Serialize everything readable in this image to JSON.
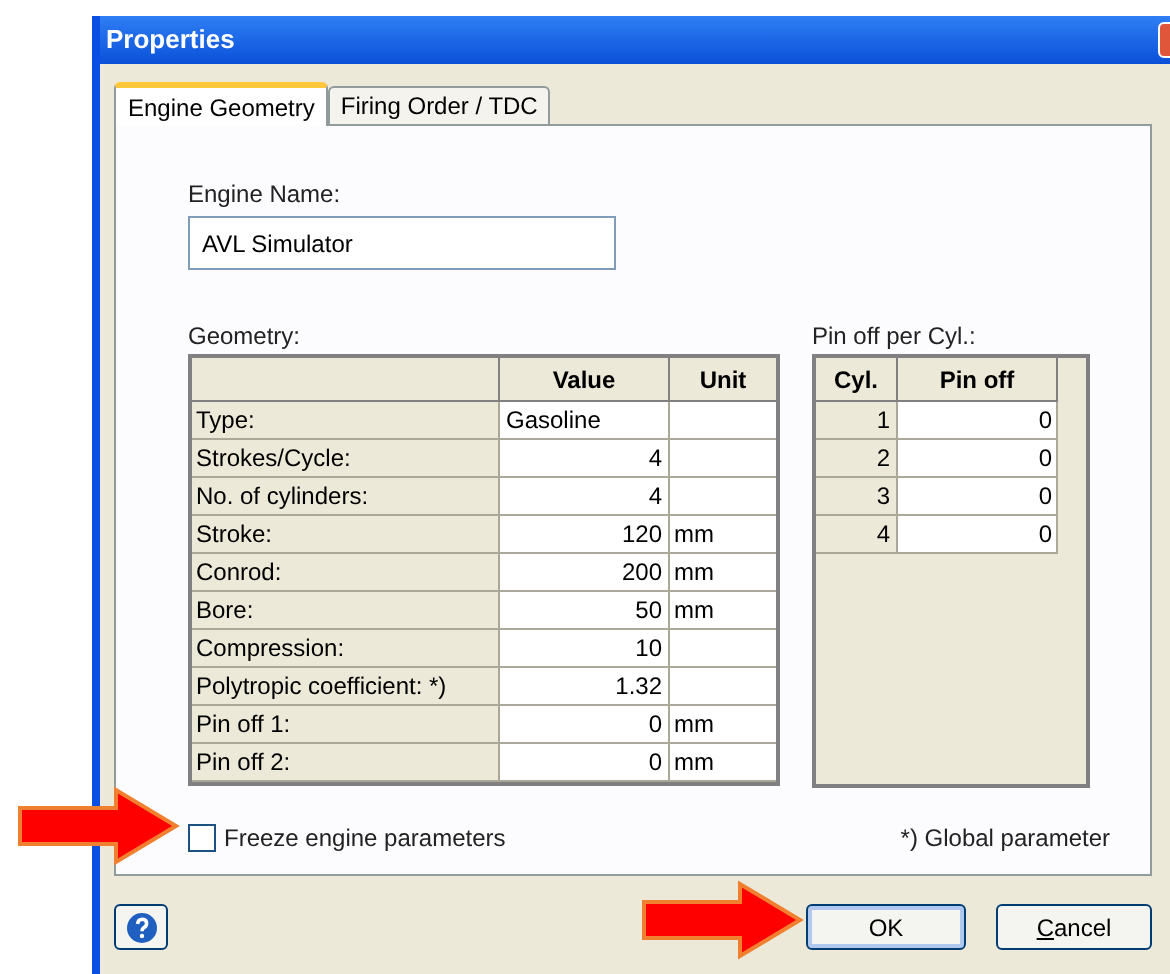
{
  "window": {
    "title": "Properties"
  },
  "tabs": [
    {
      "label": "Engine Geometry",
      "selected": true
    },
    {
      "label": "Firing Order / TDC",
      "selected": false
    }
  ],
  "engine_name": {
    "label": "Engine Name:",
    "value": "AVL Simulator"
  },
  "geometry": {
    "label": "Geometry:",
    "columns": [
      "Value",
      "Unit"
    ],
    "rows": [
      {
        "name": "Type:",
        "value": "Gasoline",
        "unit": "",
        "kind": "text"
      },
      {
        "name": "Strokes/Cycle:",
        "value": "4",
        "unit": "",
        "kind": "number"
      },
      {
        "name": "No. of cylinders:",
        "value": "4",
        "unit": "",
        "kind": "number"
      },
      {
        "name": "Stroke:",
        "value": "120",
        "unit": "mm",
        "kind": "number"
      },
      {
        "name": "Conrod:",
        "value": "200",
        "unit": "mm",
        "kind": "number"
      },
      {
        "name": "Bore:",
        "value": "50",
        "unit": "mm",
        "kind": "number"
      },
      {
        "name": "Compression:",
        "value": "10",
        "unit": "",
        "kind": "number"
      },
      {
        "name": "Polytropic coefficient: *)",
        "value": "1.32",
        "unit": "",
        "kind": "number"
      },
      {
        "name": "Pin off 1:",
        "value": "0",
        "unit": "mm",
        "kind": "number"
      },
      {
        "name": "Pin off 2:",
        "value": "0",
        "unit": "mm",
        "kind": "number"
      }
    ]
  },
  "pin_off": {
    "label": "Pin off per Cyl.:",
    "columns": [
      "Cyl.",
      "Pin off"
    ],
    "rows": [
      {
        "cyl": "1",
        "pin_off": "0"
      },
      {
        "cyl": "2",
        "pin_off": "0"
      },
      {
        "cyl": "3",
        "pin_off": "0"
      },
      {
        "cyl": "4",
        "pin_off": "0"
      }
    ]
  },
  "freeze": {
    "label": "Freeze engine parameters",
    "checked": false
  },
  "footnote": "*) Global parameter",
  "buttons": {
    "ok": "OK",
    "cancel_mnemonic": "C",
    "cancel_rest": "ancel"
  }
}
